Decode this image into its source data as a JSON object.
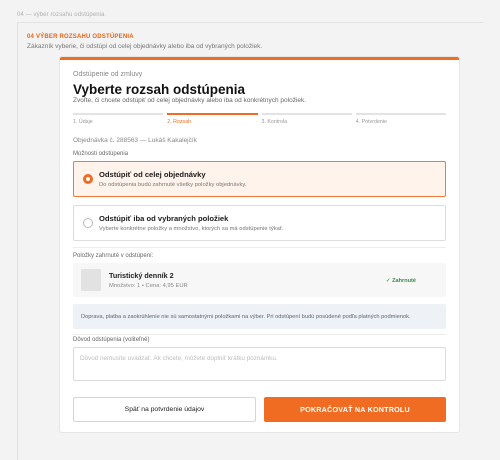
{
  "top_caption": "04 — výber rozsahu odstúpenia",
  "section": {
    "tag": "04  VÝBER ROZSAHU ODSTÚPENIA",
    "description": "Zákazník vyberie, či odstúpi od celej objednávky alebo iba od vybraných položiek."
  },
  "card": {
    "eyebrow": "Odstúpenie od zmluvy",
    "title": "Vyberte rozsah odstúpenia",
    "subtitle": "Zvoľte, či chcete odstúpiť od celej objednávky alebo iba od konkrétnych položiek.",
    "steps": [
      {
        "label": "1. Údaje",
        "active": false
      },
      {
        "label": "2. Rozsah",
        "active": true
      },
      {
        "label": "3. Kontrola",
        "active": false
      },
      {
        "label": "4. Potvrdenie",
        "active": false
      }
    ],
    "order_line": "Objednávka č. 288563 — Lukáš Kakalejčík",
    "options_label": "Možnosti odstúpenia",
    "options": [
      {
        "title": "Odstúpiť od celej objednávky",
        "desc": "Do odstúpenia budú zahrnuté všetky položky objednávky.",
        "selected": true
      },
      {
        "title": "Odstúpiť iba od vybraných položiek",
        "desc": "Vyberte konkrétne položky a množstvo, ktorých sa má odstúpenie týkať.",
        "selected": false
      }
    ],
    "items_label": "Položky zahrnuté v odstúpení:",
    "item": {
      "name": "Turistický denník 2",
      "meta": "Množstvo: 1  •  Cena: 4,95 EUR",
      "status": "✓ Zahrnuté"
    },
    "notice": "Doprava, platba a zaokrúhlenie nie sú samostatnými položkami na výber. Pri odstúpení budú posúdené podľa platných podmienok.",
    "reason_label": "Dôvod odstúpenia (voliteľné)",
    "reason_placeholder": "Dôvod nemusíte uvádzať. Ak chcete, môžete doplniť krátku poznámku.",
    "back_button": "Späť na potvrdenie údajov",
    "next_button": "POKRAČOVAŤ NA KONTROLU"
  },
  "colors": {
    "accent": "#ef6c22",
    "selected_bg": "#fff3ec",
    "success": "#3a8a45",
    "notice_bg": "#eef1f6"
  }
}
